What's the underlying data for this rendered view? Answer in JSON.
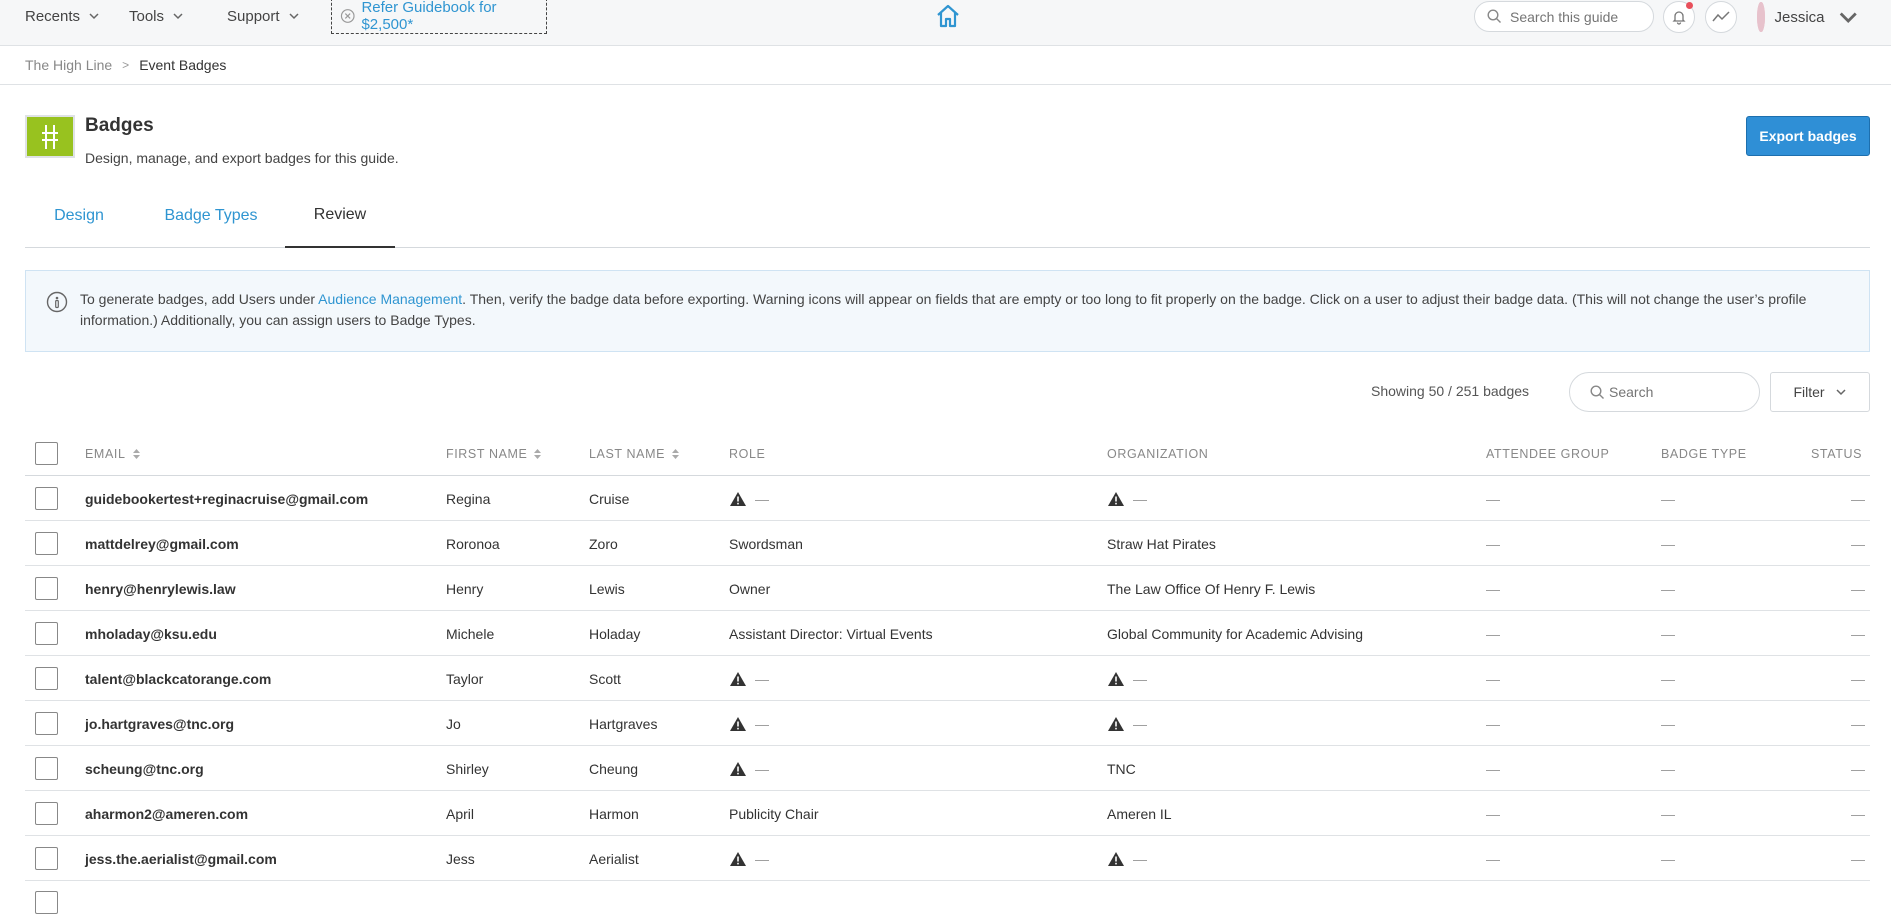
{
  "nav": {
    "recents": "Recents",
    "tools": "Tools",
    "support": "Support",
    "refer": "Refer Guidebook for $2,500*",
    "search_placeholder": "Search this guide",
    "user_name": "Jessica"
  },
  "breadcrumb": {
    "parent": "The High Line",
    "separator": ">",
    "current": "Event Badges"
  },
  "header": {
    "title": "Badges",
    "subtitle": "Design, manage, and export badges for this guide.",
    "export_button": "Export badges"
  },
  "tabs": [
    {
      "label": "Design",
      "active": false
    },
    {
      "label": "Badge Types",
      "active": false
    },
    {
      "label": "Review",
      "active": true
    }
  ],
  "info": {
    "text_before": "To generate badges, add Users under ",
    "link": "Audience Management",
    "text_after": ". Then, verify the badge data before exporting. Warning icons will appear on fields that are empty or too long to fit properly on the badge. Click on a user to adjust their badge data. (This will not change the user’s profile information.) Additionally, you can assign users to Badge Types."
  },
  "toolbar": {
    "showing": "Showing 50 / 251 badges",
    "search_placeholder": "Search",
    "filter": "Filter"
  },
  "table": {
    "columns": [
      "EMAIL",
      "FIRST NAME",
      "LAST NAME",
      "ROLE",
      "ORGANIZATION",
      "ATTENDEE GROUP",
      "BADGE TYPE",
      "STATUS"
    ],
    "empty": "—",
    "rows": [
      {
        "email": "guidebookertest+reginacruise@gmail.com",
        "first": "Regina",
        "last": "Cruise",
        "role": "",
        "org": ""
      },
      {
        "email": "mattdelrey@gmail.com",
        "first": "Roronoa",
        "last": "Zoro",
        "role": "Swordsman",
        "org": "Straw Hat Pirates"
      },
      {
        "email": "henry@henrylewis.law",
        "first": "Henry",
        "last": "Lewis",
        "role": "Owner",
        "org": "The Law Office Of Henry F. Lewis"
      },
      {
        "email": "mholaday@ksu.edu",
        "first": "Michele",
        "last": "Holaday",
        "role": "Assistant Director: Virtual Events",
        "org": "Global Community for Academic Advising"
      },
      {
        "email": "talent@blackcatorange.com",
        "first": "Taylor",
        "last": "Scott",
        "role": "",
        "org": ""
      },
      {
        "email": "jo.hartgraves@tnc.org",
        "first": "Jo",
        "last": "Hartgraves",
        "role": "",
        "org": ""
      },
      {
        "email": "scheung@tnc.org",
        "first": "Shirley",
        "last": "Cheung",
        "role": "",
        "org": "TNC"
      },
      {
        "email": "aharmon2@ameren.com",
        "first": "April",
        "last": "Harmon",
        "role": "Publicity Chair",
        "org": "Ameren IL"
      },
      {
        "email": "jess.the.aerialist@gmail.com",
        "first": "Jess",
        "last": "Aerialist",
        "role": "",
        "org": ""
      }
    ]
  },
  "colors": {
    "accent": "#2f95d1",
    "export_bg": "#2f8fd6",
    "logo_green": "#98c21f",
    "info_bg": "#f3f8fc"
  }
}
